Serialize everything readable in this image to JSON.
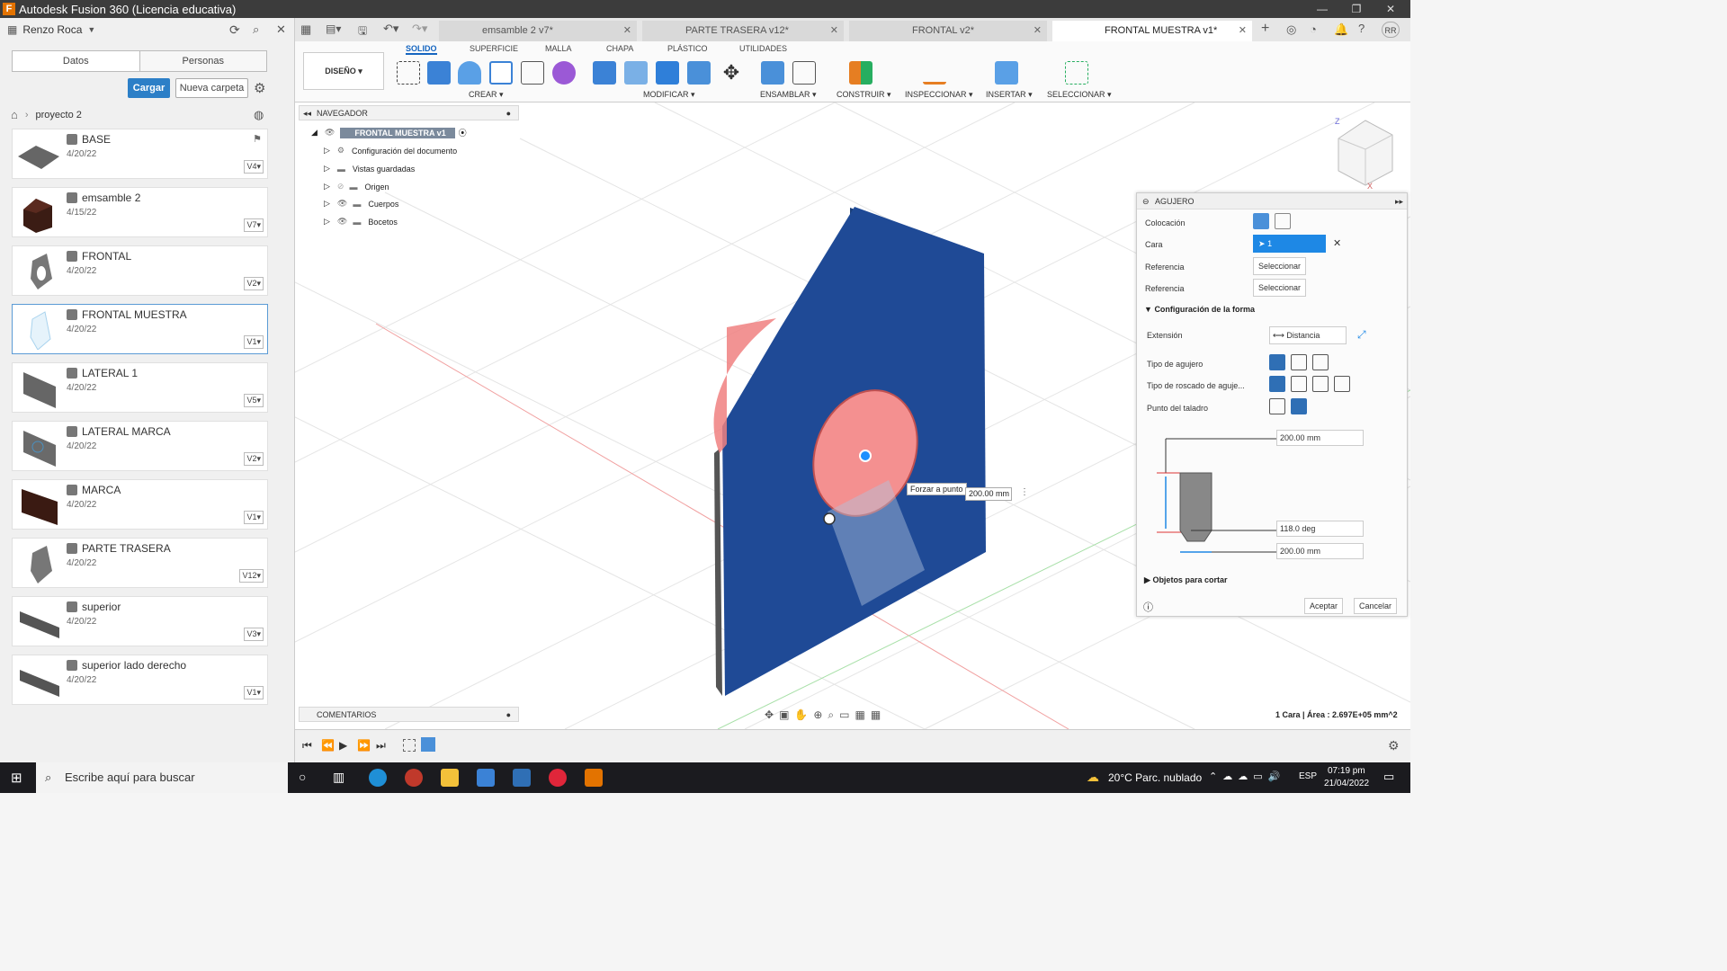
{
  "window": {
    "title": "Autodesk Fusion 360 (Licencia educativa)",
    "minimize": "—",
    "maximize": "❐",
    "close": "✕"
  },
  "datapanel": {
    "user": "Renzo Roca",
    "tabs": [
      "Datos",
      "Personas"
    ],
    "upload_label": "Cargar",
    "new_folder_label": "Nueva carpeta",
    "breadcrumb": "proyecto 2",
    "files": [
      {
        "name": "BASE",
        "date": "4/20/22",
        "version": "V4"
      },
      {
        "name": "emsamble 2",
        "date": "4/15/22",
        "version": "V7"
      },
      {
        "name": "FRONTAL",
        "date": "4/20/22",
        "version": "V2"
      },
      {
        "name": "FRONTAL MUESTRA",
        "date": "4/20/22",
        "version": "V1"
      },
      {
        "name": "LATERAL 1",
        "date": "4/20/22",
        "version": "V5"
      },
      {
        "name": "LATERAL MARCA",
        "date": "4/20/22",
        "version": "V2"
      },
      {
        "name": "MARCA",
        "date": "4/20/22",
        "version": "V1"
      },
      {
        "name": "PARTE TRASERA",
        "date": "4/20/22",
        "version": "V12"
      },
      {
        "name": "superior",
        "date": "4/20/22",
        "version": "V3"
      },
      {
        "name": "superior lado derecho",
        "date": "4/20/22",
        "version": "V1"
      }
    ]
  },
  "doc_tabs": [
    {
      "label": "emsamble 2 v7*"
    },
    {
      "label": "PARTE TRASERA v12*"
    },
    {
      "label": "FRONTAL v2*"
    },
    {
      "label": "FRONTAL MUESTRA v1*"
    }
  ],
  "user_initials": "RR",
  "toolbar": {
    "workspace": "DISEÑO ▾",
    "tabs": [
      "SOLIDO",
      "SUPERFICIE",
      "MALLA",
      "CHAPA",
      "PLÁSTICO",
      "UTILIDADES"
    ],
    "groups": [
      "CREAR ▾",
      "MODIFICAR ▾",
      "ENSAMBLAR ▾",
      "CONSTRUIR ▾",
      "INSPECCIONAR ▾",
      "INSERTAR ▾",
      "SELECCIONAR ▾"
    ]
  },
  "browser": {
    "title": "NAVEGADOR",
    "root": "FRONTAL MUESTRA v1",
    "items": [
      "Configuración del documento",
      "Vistas guardadas",
      "Origen",
      "Cuerpos",
      "Bocetos"
    ]
  },
  "viewport": {
    "snap_tooltip": "Forzar a punto",
    "distance_value": "200.00 mm",
    "status": "1 Cara | Área : 2.697E+05 mm^2",
    "comments": "COMENTARIOS"
  },
  "hole": {
    "title": "AGUJERO",
    "placement_label": "Colocación",
    "face_label": "Cara",
    "face_value": "1 seleccionado",
    "ref1_label": "Referencia",
    "ref1_value": "Seleccionar",
    "ref2_label": "Referencia",
    "ref2_value": "Seleccionar",
    "shape_section": "Configuración de la forma",
    "extent_label": "Extensión",
    "extent_value": "Distancia",
    "hole_type_label": "Tipo de agujero",
    "tap_type_label": "Tipo de roscado de aguje...",
    "drill_point_label": "Punto del taladro",
    "depth_value": "200.00 mm",
    "angle_value": "118.0 deg",
    "diameter_value": "200.00 mm",
    "objects_section": "Objetos para cortar",
    "ok_label": "Aceptar",
    "cancel_label": "Cancelar"
  },
  "taskbar": {
    "search_placeholder": "Escribe aquí para buscar",
    "weather": "20°C  Parc. nublado",
    "lang": "ESP",
    "time": "07:19 pm",
    "date": "21/04/2022"
  },
  "colors": {
    "accent": "#2c7fc7",
    "body_blue": "#1f4a96",
    "hole_red": "#f08080",
    "fusion_orange": "#e37300"
  }
}
